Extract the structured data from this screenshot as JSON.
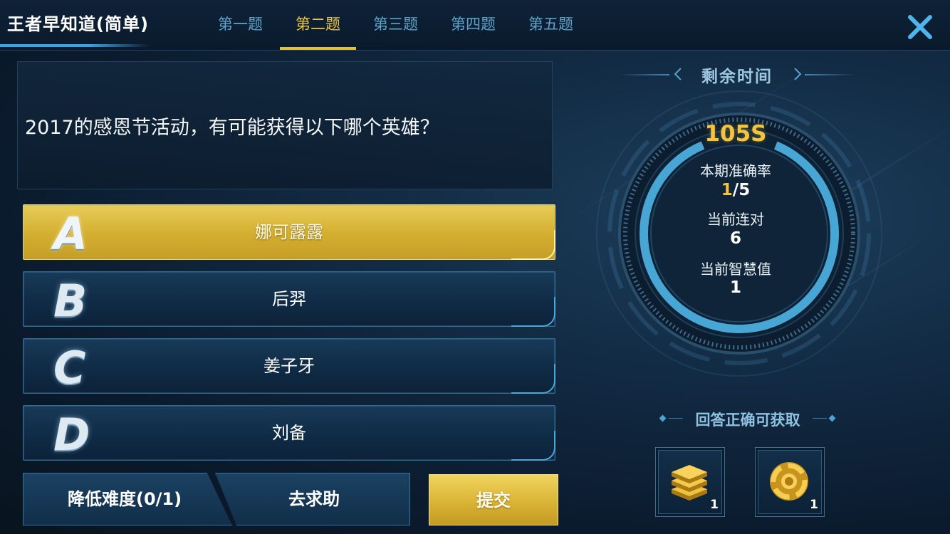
{
  "header": {
    "title": "王者早知道(简单)",
    "tabs": [
      {
        "label": "第一题",
        "active": false
      },
      {
        "label": "第二题",
        "active": true
      },
      {
        "label": "第三题",
        "active": false
      },
      {
        "label": "第四题",
        "active": false
      },
      {
        "label": "第五题",
        "active": false
      }
    ],
    "close_icon": "close-icon"
  },
  "question": {
    "text": "2017的感恩节活动，有可能获得以下哪个英雄？"
  },
  "options": [
    {
      "letter": "A",
      "text": "娜可露露",
      "selected": true
    },
    {
      "letter": "B",
      "text": "后羿",
      "selected": false
    },
    {
      "letter": "C",
      "text": "姜子牙",
      "selected": false
    },
    {
      "letter": "D",
      "text": "刘备",
      "selected": false
    }
  ],
  "actions": {
    "lower_difficulty": "降低难度(0/1)",
    "ask_help": "去求助",
    "submit": "提交"
  },
  "timer": {
    "title": "剩余时间",
    "value": "105S",
    "remaining_fraction": 0.875
  },
  "stats": {
    "accuracy_label": "本期准确率",
    "accuracy_correct": "1",
    "accuracy_total": "/5",
    "streak_label": "当前连对",
    "streak_value": "6",
    "wisdom_label": "当前智慧值",
    "wisdom_value": "1"
  },
  "rewards": {
    "title": "回答正确可获取",
    "items": [
      {
        "icon": "stacked-coins-icon",
        "count": "1"
      },
      {
        "icon": "gold-medal-icon",
        "count": "1"
      }
    ]
  },
  "colors": {
    "accent_gold": "#e4bf3c",
    "accent_blue": "#3aa3e0",
    "tab_inactive": "#5fa3c9"
  }
}
